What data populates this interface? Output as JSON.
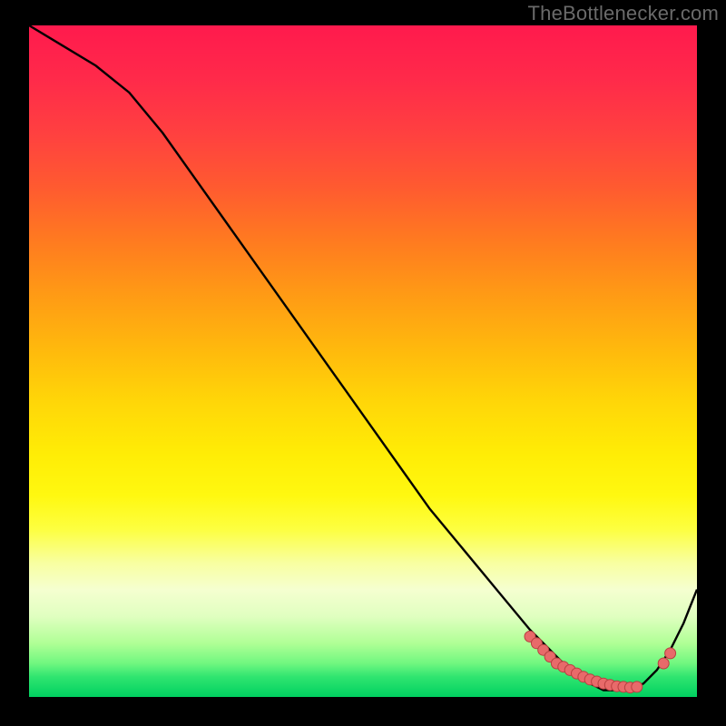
{
  "watermark": "TheBottlenecker.com",
  "chart_data": {
    "type": "line",
    "title": "",
    "xlabel": "",
    "ylabel": "",
    "xlim": [
      0,
      100
    ],
    "ylim": [
      0,
      100
    ],
    "series": [
      {
        "name": "bottleneck-curve",
        "x": [
          0,
          5,
          10,
          15,
          20,
          25,
          30,
          35,
          40,
          45,
          50,
          55,
          60,
          65,
          70,
          75,
          80,
          82,
          84,
          86,
          88,
          90,
          92,
          94,
          96,
          98,
          100
        ],
        "y": [
          100,
          97,
          94,
          90,
          84,
          77,
          70,
          63,
          56,
          49,
          42,
          35,
          28,
          22,
          16,
          10,
          5,
          3,
          2,
          1,
          1,
          1,
          2,
          4,
          7,
          11,
          16
        ]
      }
    ],
    "markers": {
      "name": "highlight-points",
      "x": [
        75,
        76,
        77,
        78,
        79,
        80,
        81,
        82,
        83,
        84,
        85,
        86,
        87,
        88,
        89,
        90,
        91,
        95,
        96
      ],
      "y": [
        9,
        8,
        7,
        6,
        5,
        4.5,
        4,
        3.5,
        3,
        2.6,
        2.3,
        2,
        1.8,
        1.6,
        1.5,
        1.4,
        1.5,
        5,
        6.5
      ]
    },
    "gradient_stops": [
      {
        "pos": 0,
        "color": "#ff1a4d"
      },
      {
        "pos": 50,
        "color": "#ffd000"
      },
      {
        "pos": 80,
        "color": "#fbff80"
      },
      {
        "pos": 100,
        "color": "#00d060"
      }
    ]
  }
}
